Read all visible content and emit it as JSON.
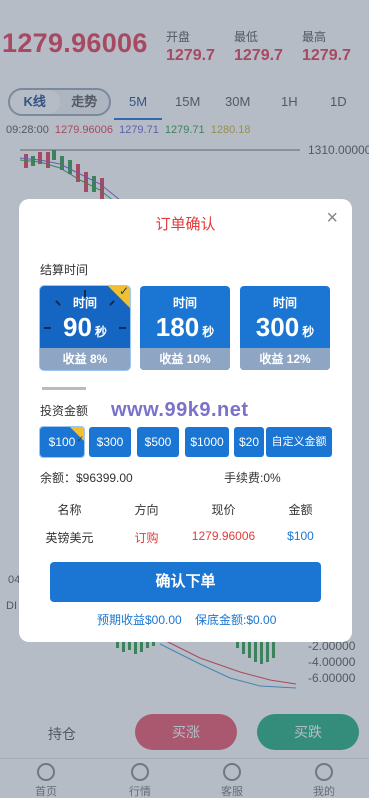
{
  "header": {
    "price": "1279.96006",
    "stats": [
      {
        "label": "开盘",
        "value": "1279.7"
      },
      {
        "label": "最低",
        "value": "1279.7"
      },
      {
        "label": "最高",
        "value": "1279.7"
      }
    ]
  },
  "tabs": {
    "segment": [
      "K线",
      "走势"
    ],
    "timeframes": [
      "5M",
      "15M",
      "30M",
      "1H",
      "1D"
    ]
  },
  "ma_line": {
    "time": "09:28:00",
    "values": [
      "1279.96006",
      "1279.71",
      "1279.71",
      "1280.18"
    ],
    "colors": [
      "#e53950",
      "#6f5fd1",
      "#2d9e4a",
      "#c7b32c"
    ]
  },
  "chart_axis": {
    "top_label": "1310.00000",
    "macd_labels": [
      "-2.00000",
      "-4.00000",
      "-6.00000"
    ],
    "left_labels": [
      "04",
      "DI"
    ]
  },
  "modal": {
    "title": "订单确认",
    "close": "×",
    "settle_label": "结算时间",
    "options": [
      {
        "label": "时间",
        "seconds": "90",
        "unit": "秒",
        "profit": "收益 8%"
      },
      {
        "label": "时间",
        "seconds": "180",
        "unit": "秒",
        "profit": "收益 10%"
      },
      {
        "label": "时间",
        "seconds": "300",
        "unit": "秒",
        "profit": "收益 12%"
      }
    ],
    "invest_label": "投资金额",
    "amounts": [
      "$100",
      "$300",
      "$500",
      "$1000",
      "$20"
    ],
    "custom_amount": "自定义金额",
    "watermark": "www.99k9.net",
    "balance": "余额：$96399.00",
    "fee": "手续费:0%",
    "table_headers": [
      "名称",
      "方向",
      "现价",
      "金额"
    ],
    "table_row": [
      "英镑美元",
      "订购",
      "1279.96006",
      "$100"
    ],
    "confirm": "确认下单",
    "expected": "预期收益$00.00",
    "guarantee": "保底金额:$0.00"
  },
  "action_bar": {
    "hold": "持仓",
    "buy_up": "买涨",
    "buy_down": "买跌"
  },
  "tabbar": [
    "首页",
    "行情",
    "客服",
    "我的"
  ]
}
